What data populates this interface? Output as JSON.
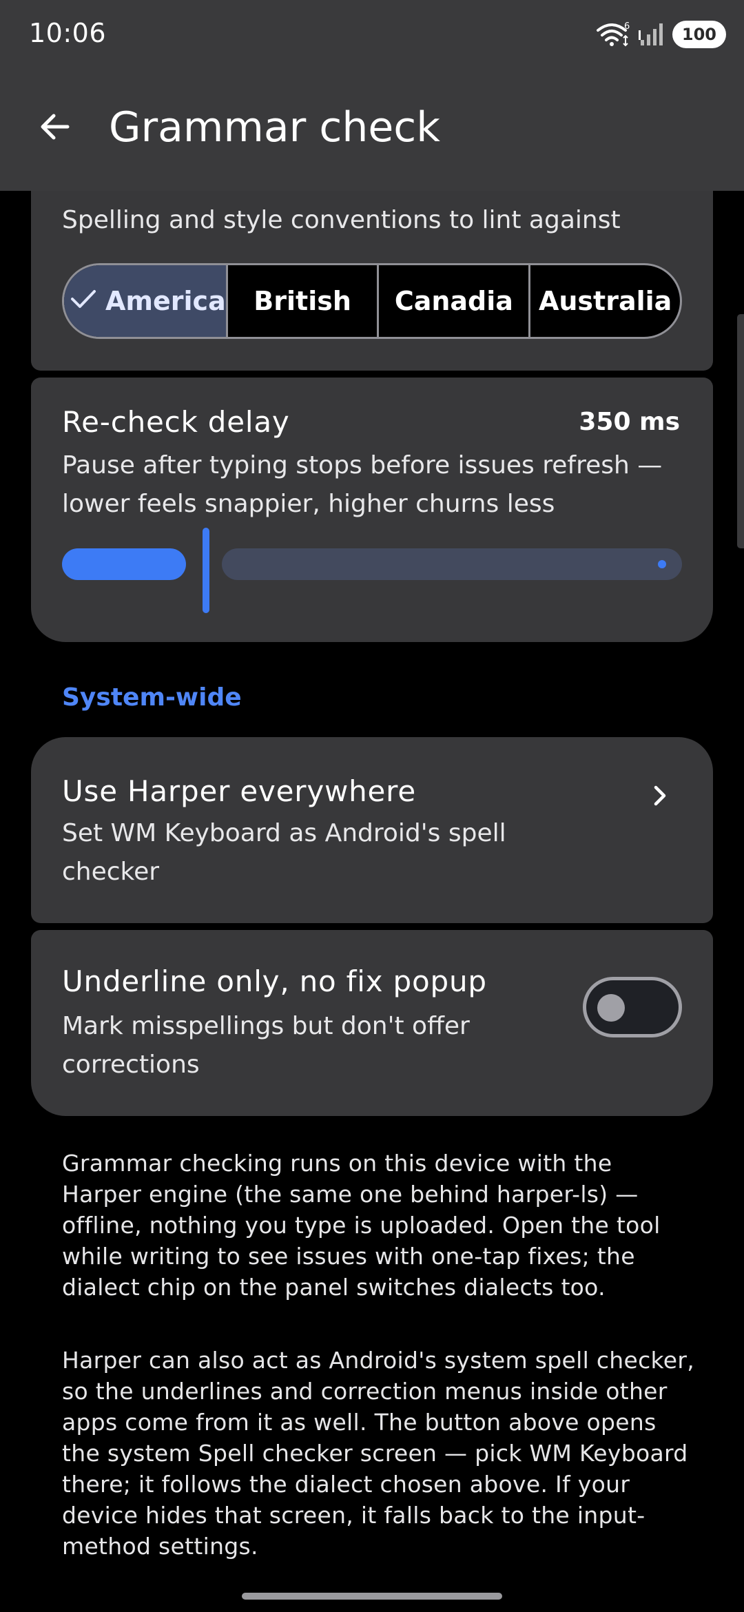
{
  "status_bar": {
    "time": "10:06",
    "wifi_badge": "6",
    "battery": "100",
    "icons": [
      "wifi-icon",
      "signal-icon",
      "battery-icon"
    ]
  },
  "app_bar": {
    "title": "Grammar check",
    "back_icon": "arrow-left-icon"
  },
  "dialect": {
    "subtitle": "Spelling and style conventions to lint against",
    "options": [
      "America",
      "British",
      "Canadia",
      "Australia"
    ],
    "selected": "America"
  },
  "recheck_delay": {
    "title": "Re-check delay",
    "value": "350 ms",
    "description": "Pause after typing stops before issues refresh — lower feels snappier, higher churns less",
    "slider_fraction": 0.12
  },
  "system_wide": {
    "header": "System-wide",
    "harper": {
      "title": "Use Harper everywhere",
      "description": "Set WM Keyboard as Android's spell checker"
    },
    "underline_only": {
      "title": "Underline only, no fix popup",
      "description": "Mark misspellings but don't offer corrections",
      "enabled": false
    }
  },
  "info": {
    "paragraph_1": "Grammar checking runs on this device with the Harper engine (the same one behind harper-ls) — offline, nothing you type is uploaded. Open the tool while writing to see issues with one-tap fixes; the dialect chip on the panel switches dialects too.",
    "paragraph_2": "Harper can also act as Android's system spell checker, so the underlines and correction menus inside other apps come from it as well. The button above opens the system Spell checker screen — pick WM Keyboard there; it follows the dialect chosen above. If your device hides that screen, it falls back to the input-method settings."
  },
  "colors": {
    "accent": "#3d7bf5",
    "section_header": "#4f86f7",
    "card": "#38383a",
    "topbar": "#3a3a3c",
    "background": "#000000"
  }
}
